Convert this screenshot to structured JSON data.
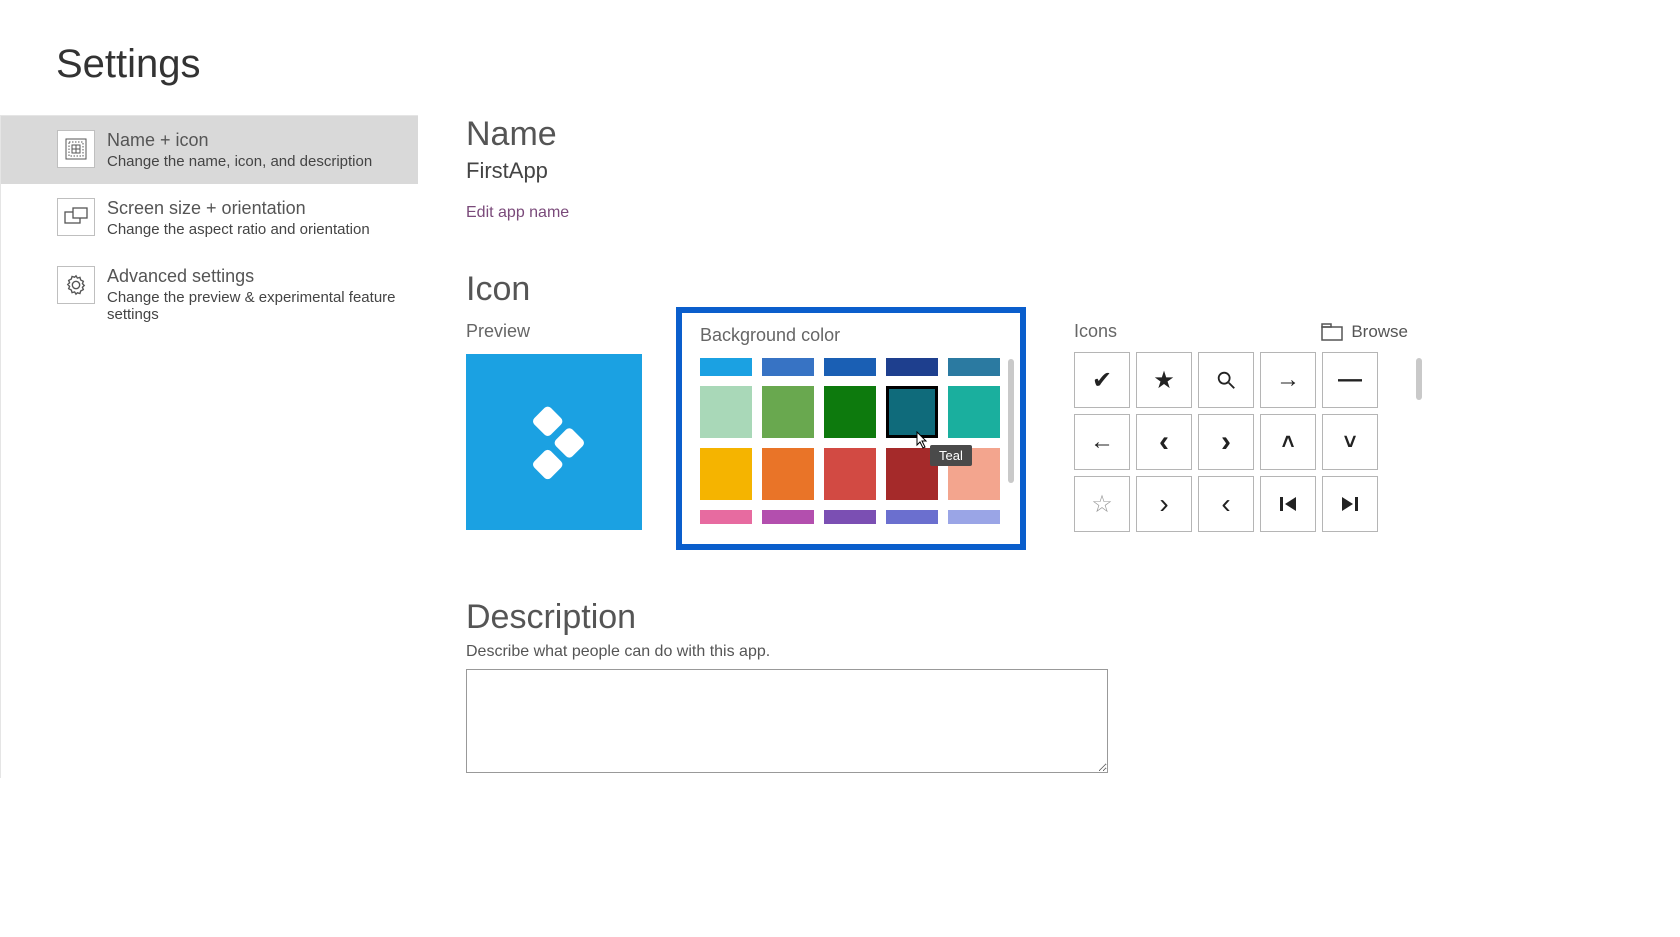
{
  "page_title": "Settings",
  "sidebar": {
    "items": [
      {
        "title": "Name + icon",
        "sub": "Change the name, icon, and description"
      },
      {
        "title": "Screen size + orientation",
        "sub": "Change the aspect ratio and orientation"
      },
      {
        "title": "Advanced settings",
        "sub": "Change the preview & experimental feature settings"
      }
    ]
  },
  "name": {
    "heading": "Name",
    "value": "FirstApp",
    "edit_link": "Edit app name"
  },
  "icon": {
    "heading": "Icon",
    "preview_label": "Preview",
    "bg_label": "Background color",
    "icons_label": "Icons",
    "browse_label": "Browse",
    "tooltip": "Teal",
    "colors_row0": [
      "#1ba1e2",
      "#3773c4",
      "#1a5fb4",
      "#1e3f8e",
      "#2b7aa1"
    ],
    "colors_row1": [
      "#a9d8b8",
      "#69a84f",
      "#0d7a0d",
      "#0f6b7b",
      "#1aaf9e"
    ],
    "colors_row2": [
      "#f5b400",
      "#e97428",
      "#d24a43",
      "#a52a2a",
      "#f3a58e"
    ],
    "colors_row3": [
      "#e76ba0",
      "#b34fae",
      "#7b4fb3",
      "#6b6fcf",
      "#9aa5e6"
    ]
  },
  "description": {
    "heading": "Description",
    "sub": "Describe what people can do with this app.",
    "value": ""
  }
}
